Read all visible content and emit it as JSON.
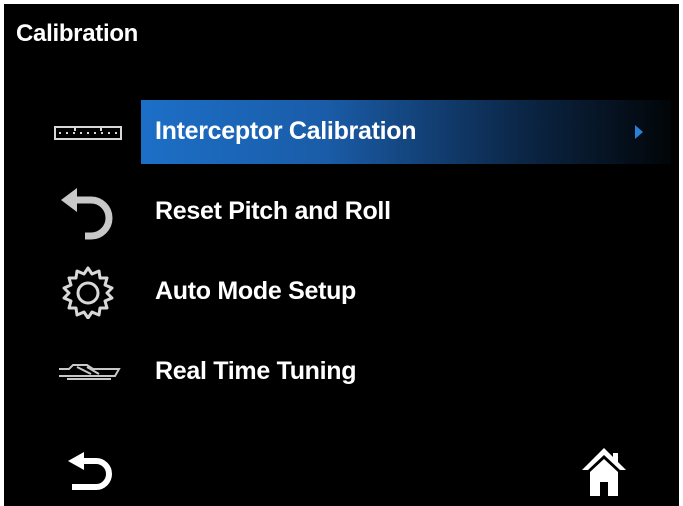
{
  "header": {
    "title": "Calibration"
  },
  "menu": {
    "items": [
      {
        "label": "Interceptor Calibration",
        "icon": "interceptor-icon",
        "selected": true
      },
      {
        "label": "Reset Pitch and Roll",
        "icon": "reset-arrow-icon",
        "selected": false
      },
      {
        "label": "Auto Mode Setup",
        "icon": "gear-icon",
        "selected": false
      },
      {
        "label": "Real Time Tuning",
        "icon": "boat-icon",
        "selected": false
      }
    ]
  },
  "footer": {
    "back_icon": "back-icon",
    "home_icon": "home-icon"
  },
  "colors": {
    "background": "#000000",
    "highlight_start": "#1c6fc7",
    "highlight_end": "#020508",
    "text": "#ffffff",
    "icon": "#dcdcdc",
    "arrow": "#2c7fd6"
  }
}
